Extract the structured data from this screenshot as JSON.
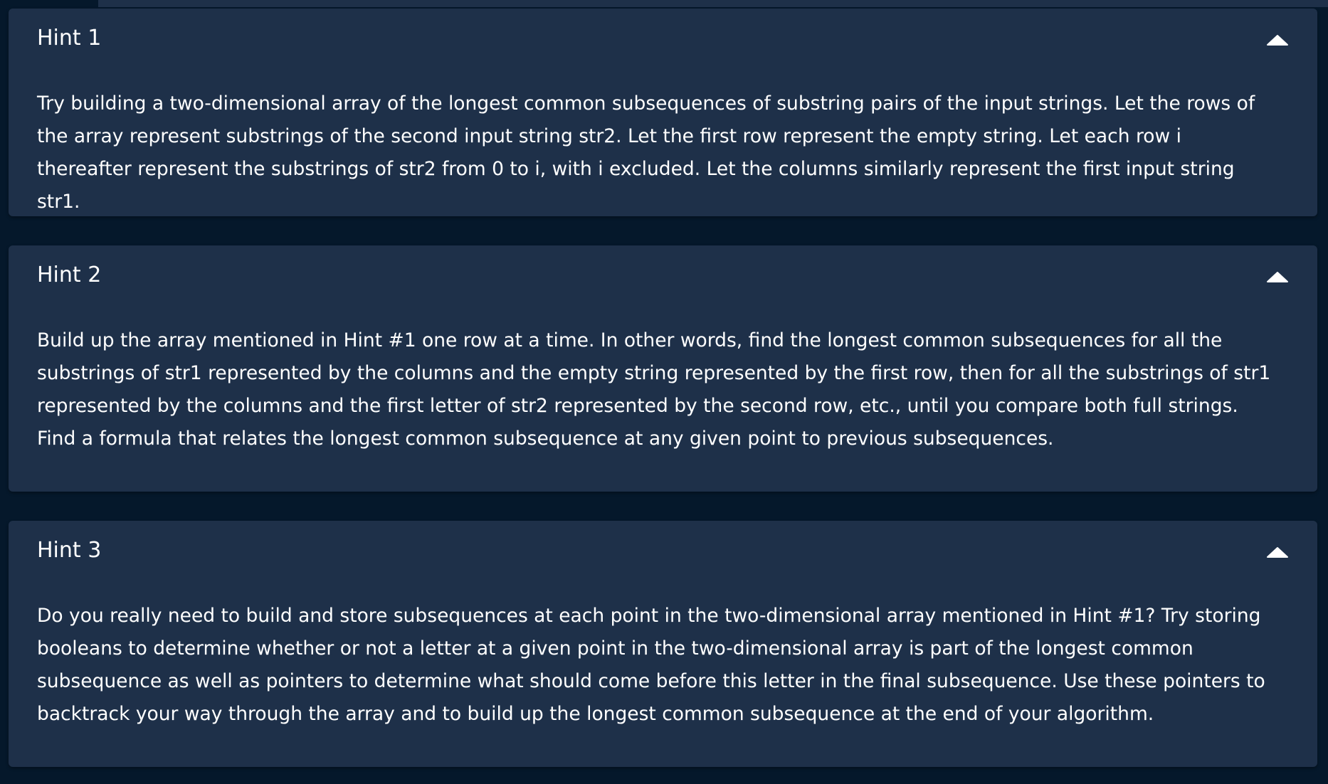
{
  "hints": [
    {
      "title": "Hint 1",
      "body": "Try building a two-dimensional array of the longest common subsequences of substring pairs of the input strings. Let the rows of the array represent substrings of the second input string str2. Let the first row represent the empty string. Let each row i thereafter represent the substrings of str2 from 0 to i, with i excluded. Let the columns similarly represent the first input string str1.",
      "toggle_icon": "chevron-up-icon"
    },
    {
      "title": "Hint 2",
      "body": "Build up the array mentioned in Hint #1 one row at a time. In other words, find the longest common subsequences for all the substrings of str1 represented by the columns and the empty string represented by the first row, then for all the substrings of str1 represented by the columns and the first letter of str2 represented by the second row, etc., until you compare both full strings. Find a formula that relates the longest common subsequence at any given point to previous subsequences.",
      "toggle_icon": "chevron-up-icon"
    },
    {
      "title": "Hint 3",
      "body": "Do you really need to build and store subsequences at each point in the two-dimensional array mentioned in Hint #1? Try storing booleans to determine whether or not a letter at a given point in the two-dimensional array is part of the longest common subsequence as well as pointers to determine what should come before this letter in the final subsequence. Use these pointers to backtrack your way through the array and to build up the longest common subsequence at the end of your algorithm.",
      "toggle_icon": "chevron-up-icon"
    }
  ],
  "colors": {
    "page_background": "#05182b",
    "card_background": "#1e3049",
    "text": "#ffffff"
  }
}
